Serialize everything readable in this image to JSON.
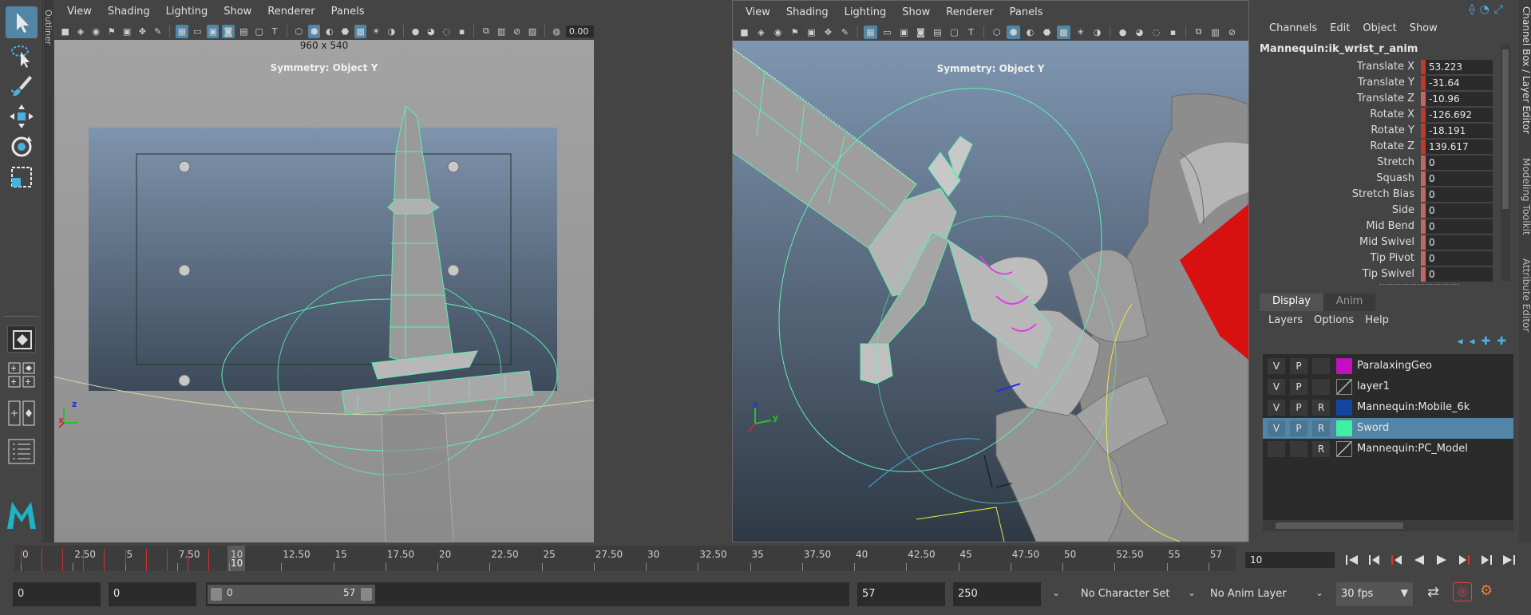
{
  "toolbox": {
    "tools": [
      "select-tool",
      "lasso-tool",
      "paint-tool",
      "move-tool",
      "rotate-tool",
      "scale-tool"
    ]
  },
  "outliner": {
    "label": "Outliner"
  },
  "viewport_left": {
    "menu": [
      "View",
      "Shading",
      "Lighting",
      "Show",
      "Renderer",
      "Panels"
    ],
    "resolution": "960 x 540",
    "symmetry": "Symmetry: Object Y",
    "exposure": "0.00",
    "axis_x": "x",
    "axis_z": "z"
  },
  "viewport_right": {
    "menu": [
      "View",
      "Shading",
      "Lighting",
      "Show",
      "Renderer",
      "Panels"
    ],
    "symmetry": "Symmetry: Object Y",
    "axis_y": "y",
    "axis_z": "z"
  },
  "channel_box": {
    "menu": [
      "Channels",
      "Edit",
      "Object",
      "Show"
    ],
    "node": "Mannequin:ik_wrist_r_anim",
    "attributes": [
      {
        "label": "Translate X",
        "value": "53.223",
        "key_color": "#c0392b"
      },
      {
        "label": "Translate Y",
        "value": "-31.64",
        "key_color": "#c0392b"
      },
      {
        "label": "Translate Z",
        "value": "-10.96",
        "key_color": "#c46565"
      },
      {
        "label": "Rotate X",
        "value": "-126.692",
        "key_color": "#c0392b"
      },
      {
        "label": "Rotate Y",
        "value": "-18.191",
        "key_color": "#c0392b"
      },
      {
        "label": "Rotate Z",
        "value": "139.617",
        "key_color": "#c0392b"
      },
      {
        "label": "Stretch",
        "value": "0",
        "key_color": "#c46565"
      },
      {
        "label": "Squash",
        "value": "0",
        "key_color": "#c46565"
      },
      {
        "label": "Stretch Bias",
        "value": "0",
        "key_color": "#c46565"
      },
      {
        "label": "Side",
        "value": "0",
        "key_color": "#c46565"
      },
      {
        "label": "Mid Bend",
        "value": "0",
        "key_color": "#c46565"
      },
      {
        "label": "Mid Swivel",
        "value": "0",
        "key_color": "#c46565"
      },
      {
        "label": "Tip Pivot",
        "value": "0",
        "key_color": "#c46565"
      },
      {
        "label": "Tip Swivel",
        "value": "0",
        "key_color": "#c46565"
      }
    ]
  },
  "layer_editor": {
    "tabs": [
      "Display",
      "Anim"
    ],
    "menu": [
      "Layers",
      "Options",
      "Help"
    ],
    "layers": [
      {
        "v": "V",
        "p": "P",
        "r": "",
        "color": "#c010c0",
        "name": "ParalaxingGeo",
        "selected": false
      },
      {
        "v": "V",
        "p": "P",
        "r": "",
        "color": "",
        "name": "layer1",
        "selected": false
      },
      {
        "v": "V",
        "p": "P",
        "r": "R",
        "color": "#1446a0",
        "name": "Mannequin:Mobile_6k",
        "selected": false
      },
      {
        "v": "V",
        "p": "P",
        "r": "R",
        "color": "#40f0a0",
        "name": "Sword",
        "selected": true
      },
      {
        "v": "",
        "p": "",
        "r": "R",
        "color": "",
        "name": "Mannequin:PC_Model",
        "selected": false
      }
    ]
  },
  "side_tabs": [
    "Channel Box / Layer Editor",
    "Modeling Toolkit",
    "Attribute Editor"
  ],
  "timeline": {
    "ticks": [
      "0",
      "2.50",
      "5",
      "7.50",
      "10",
      "12.50",
      "15",
      "17.50",
      "20",
      "22.50",
      "25",
      "27.50",
      "30",
      "32.50",
      "35",
      "37.50",
      "40",
      "42.50",
      "45",
      "47.50",
      "50",
      "52.50",
      "55",
      "57"
    ],
    "current_frame": "10",
    "frame_field": "10"
  },
  "range": {
    "anim_start": "0",
    "playback_start": "0",
    "slider_start": "0",
    "slider_end": "57",
    "playback_end": "57",
    "anim_end": "250",
    "character_set": "No Character Set",
    "anim_layer": "No Anim Layer",
    "fps": "30 fps"
  }
}
